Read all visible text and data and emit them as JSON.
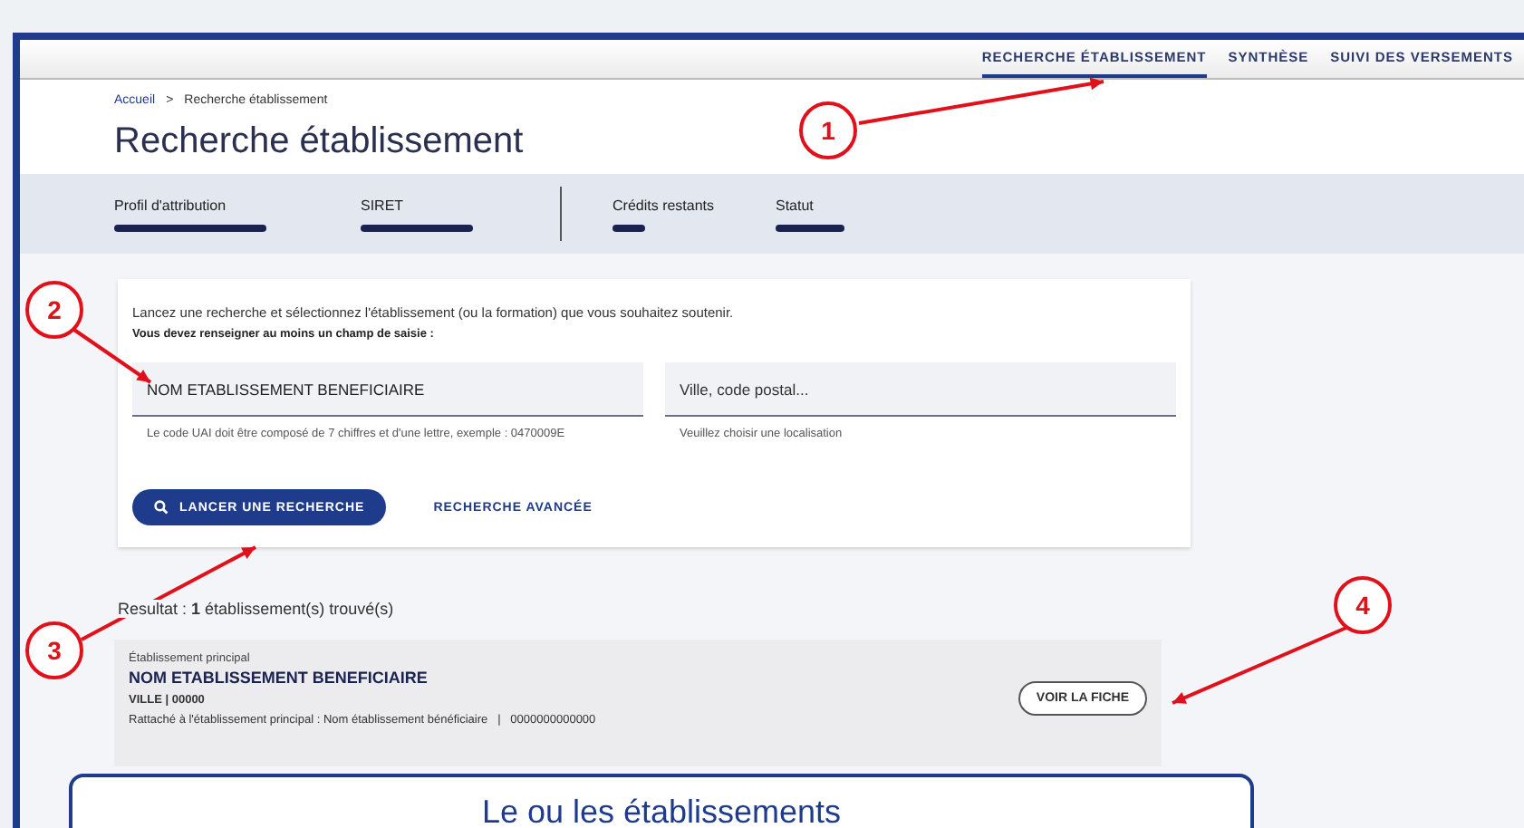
{
  "nav": {
    "tabs": [
      {
        "label": "RECHERCHE ÉTABLISSEMENT",
        "selected": true
      },
      {
        "label": "SYNTHÈSE",
        "selected": false
      },
      {
        "label": "SUIVI DES VERSEMENTS",
        "selected": false
      }
    ]
  },
  "breadcrumb": {
    "home": "Accueil",
    "separator": ">",
    "current": "Recherche établissement"
  },
  "title": "Recherche établissement",
  "stats": [
    {
      "label": "Profil d'attribution"
    },
    {
      "label": "SIRET"
    },
    {
      "label": "Crédits restants"
    },
    {
      "label": "Statut"
    }
  ],
  "search": {
    "intro": "Lancez une recherche et sélectionnez l'établissement (ou la formation) que vous souhaitez soutenir.",
    "required": "Vous devez renseigner au moins un champ de saisie :",
    "fields": [
      {
        "value": "NOM ETABLISSEMENT BENEFICIAIRE",
        "hint": "Le code UAI doit être composé de 7 chiffres et d'une lettre, exemple : 0470009E"
      },
      {
        "placeholder": "Ville, code postal...",
        "hint": "Veuillez choisir une localisation"
      }
    ],
    "button": "LANCER UNE RECHERCHE",
    "advanced": "RECHERCHE AVANCÉE"
  },
  "results": {
    "summary": "Resultat : **1** établissement(s) trouvé(s)",
    "card": {
      "type": "Établissement principal",
      "name": "NOM ETABLISSEMENT BENEFICIAIRE",
      "city": "VILLE | 00000",
      "attached": "Rattaché à l'établissement principal : Nom établissement bénéficiaire   |   0000000000000",
      "button": "VOIR LA FICHE"
    }
  },
  "annotations": [
    {
      "number": "1"
    },
    {
      "number": "2"
    },
    {
      "number": "3"
    },
    {
      "number": "4"
    }
  ],
  "caption": "Le ou les établissements"
}
